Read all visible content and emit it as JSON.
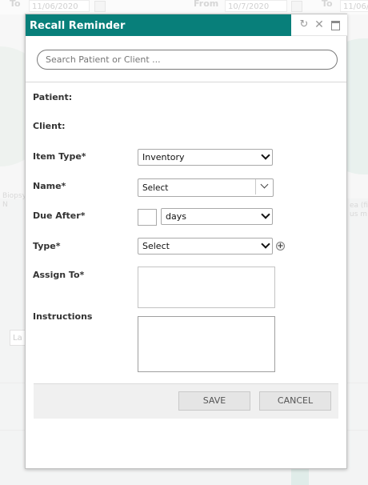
{
  "background": {
    "to_label_left": "To",
    "date_left": "11/06/2020",
    "from_label": "From",
    "date_from": "10/7/2020",
    "to_label_right": "To",
    "date_right": "11/06/",
    "side_text_left": "Biopsy\nN",
    "side_text_right": "ea (fir\nus m",
    "la_field": "La"
  },
  "dialog": {
    "title": "Recall Reminder",
    "search": {
      "placeholder": "Search Patient or Client ...",
      "value": ""
    },
    "fields": {
      "patient_label": "Patient:",
      "client_label": "Client:",
      "item_type_label": "Item Type*",
      "item_type_value": "Inventory",
      "name_label": "Name*",
      "name_value": "Select",
      "due_after_label": "Due After*",
      "due_after_number": "",
      "due_after_unit": "days",
      "type_label": "Type*",
      "type_value": "Select",
      "assign_to_label": "Assign To*",
      "instructions_label": "Instructions"
    },
    "buttons": {
      "save": "SAVE",
      "cancel": "CANCEL"
    }
  },
  "colors": {
    "titlebar": "#087f7a",
    "button_bg": "#e5e5e5",
    "footer_bg": "#f0f0f0"
  }
}
